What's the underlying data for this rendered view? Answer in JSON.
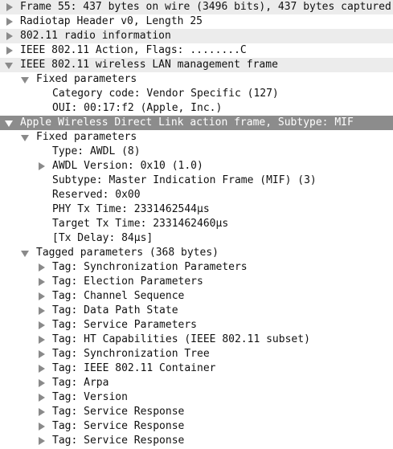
{
  "tree": [
    {
      "text": "Frame 55: 437 bytes on wire (3496 bits), 437 bytes captured",
      "level": 0,
      "expander": "collapsed",
      "bg": "gray"
    },
    {
      "text": "Radiotap Header v0, Length 25",
      "level": 0,
      "expander": "collapsed",
      "bg": "none"
    },
    {
      "text": "802.11 radio information",
      "level": 0,
      "expander": "collapsed",
      "bg": "gray"
    },
    {
      "text": "IEEE 802.11 Action, Flags: ........C",
      "level": 0,
      "expander": "collapsed",
      "bg": "none"
    },
    {
      "text": "IEEE 802.11 wireless LAN management frame",
      "level": 0,
      "expander": "expanded",
      "bg": "gray"
    },
    {
      "text": "Fixed parameters",
      "level": 1,
      "expander": "expanded",
      "bg": "none"
    },
    {
      "text": "Category code: Vendor Specific (127)",
      "level": 2,
      "expander": "none",
      "bg": "none"
    },
    {
      "text": "OUI: 00:17:f2 (Apple, Inc.)",
      "level": 2,
      "expander": "none",
      "bg": "none"
    },
    {
      "text": "Apple Wireless Direct Link action frame, Subtype: MIF",
      "level": 0,
      "expander": "expanded",
      "bg": "selected"
    },
    {
      "text": "Fixed parameters",
      "level": 1,
      "expander": "expanded",
      "bg": "none"
    },
    {
      "text": "Type: AWDL (8)",
      "level": 2,
      "expander": "none",
      "bg": "none"
    },
    {
      "text": "AWDL Version: 0x10 (1.0)",
      "level": 2,
      "expander": "collapsed",
      "bg": "none"
    },
    {
      "text": "Subtype: Master Indication Frame (MIF) (3)",
      "level": 2,
      "expander": "none",
      "bg": "none"
    },
    {
      "text": "Reserved: 0x00",
      "level": 2,
      "expander": "none",
      "bg": "none"
    },
    {
      "text": "PHY Tx Time: 2331462544µs",
      "level": 2,
      "expander": "none",
      "bg": "none"
    },
    {
      "text": "Target Tx Time: 2331462460µs",
      "level": 2,
      "expander": "none",
      "bg": "none"
    },
    {
      "text": "[Tx Delay: 84µs]",
      "level": 2,
      "expander": "none",
      "bg": "none"
    },
    {
      "text": "Tagged parameters (368 bytes)",
      "level": 1,
      "expander": "expanded",
      "bg": "none"
    },
    {
      "text": "Tag: Synchronization Parameters",
      "level": 2,
      "expander": "collapsed",
      "bg": "none"
    },
    {
      "text": "Tag: Election Parameters",
      "level": 2,
      "expander": "collapsed",
      "bg": "none"
    },
    {
      "text": "Tag: Channel Sequence",
      "level": 2,
      "expander": "collapsed",
      "bg": "none"
    },
    {
      "text": "Tag: Data Path State",
      "level": 2,
      "expander": "collapsed",
      "bg": "none"
    },
    {
      "text": "Tag: Service Parameters",
      "level": 2,
      "expander": "collapsed",
      "bg": "none"
    },
    {
      "text": "Tag: HT Capabilities (IEEE 802.11 subset)",
      "level": 2,
      "expander": "collapsed",
      "bg": "none"
    },
    {
      "text": "Tag: Synchronization Tree",
      "level": 2,
      "expander": "collapsed",
      "bg": "none"
    },
    {
      "text": "Tag: IEEE 802.11 Container",
      "level": 2,
      "expander": "collapsed",
      "bg": "none"
    },
    {
      "text": "Tag: Arpa",
      "level": 2,
      "expander": "collapsed",
      "bg": "none"
    },
    {
      "text": "Tag: Version",
      "level": 2,
      "expander": "collapsed",
      "bg": "none"
    },
    {
      "text": "Tag: Service Response",
      "level": 2,
      "expander": "collapsed",
      "bg": "none"
    },
    {
      "text": "Tag: Service Response",
      "level": 2,
      "expander": "collapsed",
      "bg": "none"
    },
    {
      "text": "Tag: Service Response",
      "level": 2,
      "expander": "collapsed",
      "bg": "none"
    }
  ],
  "colors": {
    "row_gray": "#ececec",
    "row_selected": "#8c8c8c",
    "expander": "#8a8a8a",
    "text": "#111111",
    "selected_text": "#ffffff"
  },
  "icons": {
    "collapsed": "triangle-right-icon",
    "expanded": "triangle-down-icon"
  }
}
